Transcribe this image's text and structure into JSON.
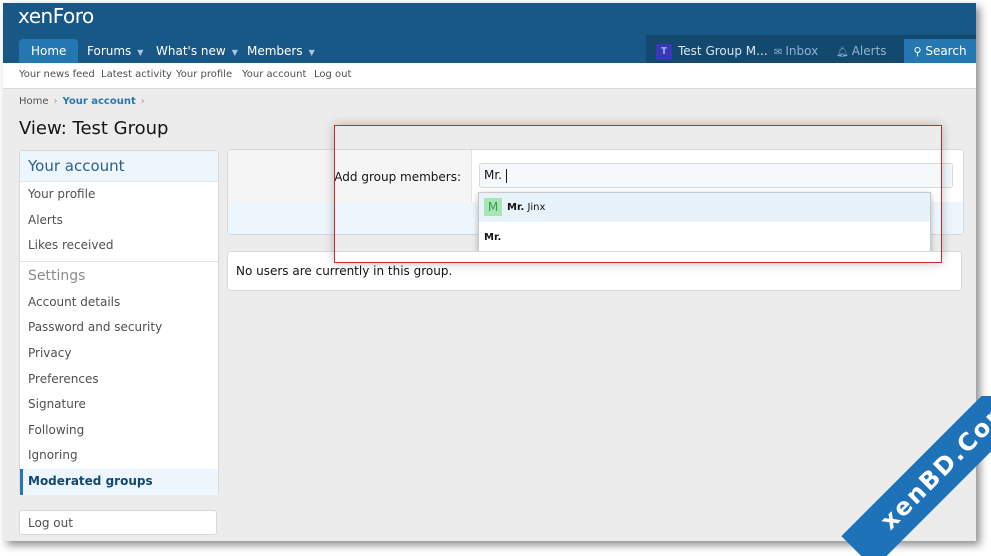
{
  "logo": "xenForo",
  "nav": {
    "items": [
      {
        "label": "Home",
        "chevron": false
      },
      {
        "label": "Forums",
        "chevron": true
      },
      {
        "label": "What's new",
        "chevron": true
      },
      {
        "label": "Members",
        "chevron": true
      }
    ],
    "account": {
      "avatar_letter": "T",
      "username": "Test Group M...",
      "inbox": "Inbox",
      "alerts": "Alerts",
      "search": "Search"
    }
  },
  "subnav": [
    "Your news feed",
    "Latest activity",
    "Your profile",
    "Your account",
    "Log out"
  ],
  "breadcrumb": {
    "home": "Home",
    "current": "Your account"
  },
  "page_title": "View: Test Group",
  "sidebar": {
    "heading": "Your account",
    "items": [
      "Your profile",
      "Alerts",
      "Likes received"
    ],
    "settings_heading": "Settings",
    "settings_items": [
      "Account details",
      "Password and security",
      "Privacy",
      "Preferences",
      "Signature",
      "Following",
      "Ignoring",
      "Moderated groups"
    ],
    "active_item": "Moderated groups",
    "logout": "Log out"
  },
  "form": {
    "label": "Add group members:",
    "input_value": "Mr."
  },
  "autocomplete": {
    "items": [
      {
        "avatar_letter": "M",
        "bold": "Mr.",
        "rest": " Jinx"
      },
      {
        "avatar_letter": "",
        "bold": "Mr.",
        "rest": ""
      }
    ]
  },
  "empty_message": "No users are currently in this group.",
  "watermark": "xenBD.Com",
  "colors": {
    "header": "#185886",
    "accent": "#2577b1",
    "highlight_border": "#cc2a2a"
  }
}
